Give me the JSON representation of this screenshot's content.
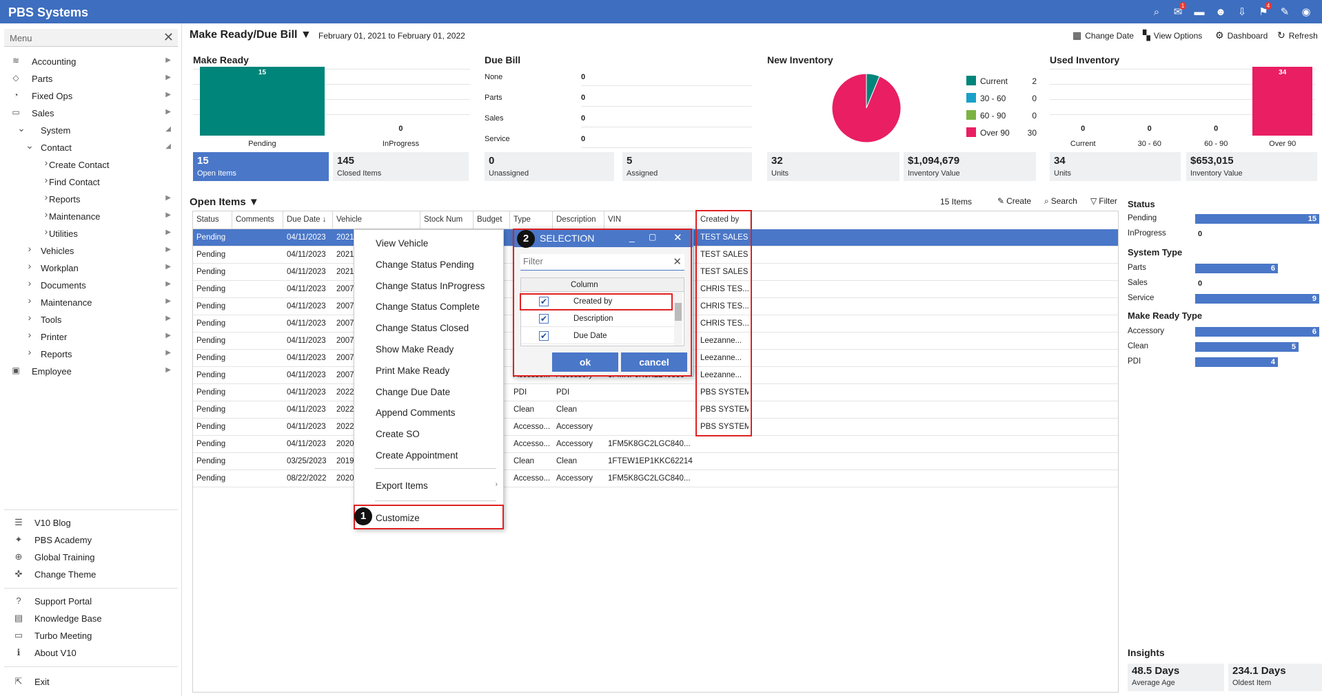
{
  "app_title": "PBS Systems",
  "topbar_icons": [
    {
      "name": "search-icon",
      "glyph": "⌕",
      "badge": ""
    },
    {
      "name": "mail-icon",
      "glyph": "✉",
      "badge": "1"
    },
    {
      "name": "chat-icon",
      "glyph": "▬",
      "badge": ""
    },
    {
      "name": "users-icon",
      "glyph": "☻",
      "badge": ""
    },
    {
      "name": "inbox-icon",
      "glyph": "⇩",
      "badge": ""
    },
    {
      "name": "flag-icon",
      "glyph": "⚑",
      "badge": "4"
    },
    {
      "name": "pin-icon",
      "glyph": "✎",
      "badge": ""
    },
    {
      "name": "eye-icon",
      "glyph": "◉",
      "badge": ""
    }
  ],
  "sidebar": {
    "header": "Menu",
    "items": [
      {
        "label": "Accounting",
        "icon": "database-icon",
        "glyph": "≋",
        "indent": 0,
        "expander": "",
        "arrow": "▶"
      },
      {
        "label": "Parts",
        "icon": "tag-icon",
        "glyph": "◇",
        "indent": 0,
        "expander": "",
        "arrow": "▶"
      },
      {
        "label": "Fixed Ops",
        "icon": "gauge-icon",
        "glyph": "◔",
        "indent": 0,
        "expander": "",
        "arrow": "▶"
      },
      {
        "label": "Sales",
        "icon": "car-icon",
        "glyph": "▭",
        "indent": 0,
        "expander": "",
        "arrow": "▶"
      },
      {
        "label": "System",
        "icon": "expand-icon",
        "glyph": "",
        "indent": 0,
        "expander": "⌄",
        "arrow": "◢"
      },
      {
        "label": "Contact",
        "icon": "expand-icon",
        "glyph": "",
        "indent": 1,
        "expander": "⌄",
        "arrow": "◢"
      },
      {
        "label": "Create Contact",
        "icon": "chevron-right-icon",
        "glyph": "",
        "indent": 2,
        "expander": "›",
        "arrow": ""
      },
      {
        "label": "Find Contact",
        "icon": "chevron-right-icon",
        "glyph": "",
        "indent": 2,
        "expander": "›",
        "arrow": ""
      },
      {
        "label": "Reports",
        "icon": "chevron-right-icon",
        "glyph": "",
        "indent": 2,
        "expander": "›",
        "arrow": "▶"
      },
      {
        "label": "Maintenance",
        "icon": "chevron-right-icon",
        "glyph": "",
        "indent": 2,
        "expander": "›",
        "arrow": "▶"
      },
      {
        "label": "Utilities",
        "icon": "chevron-right-icon",
        "glyph": "",
        "indent": 2,
        "expander": "›",
        "arrow": "▶"
      },
      {
        "label": "Vehicles",
        "icon": "chevron-right-icon",
        "glyph": "",
        "indent": 1,
        "expander": "›",
        "arrow": "▶"
      },
      {
        "label": "Workplan",
        "icon": "chevron-right-icon",
        "glyph": "",
        "indent": 1,
        "expander": "›",
        "arrow": "▶"
      },
      {
        "label": "Documents",
        "icon": "chevron-right-icon",
        "glyph": "",
        "indent": 1,
        "expander": "›",
        "arrow": "▶"
      },
      {
        "label": "Maintenance",
        "icon": "chevron-right-icon",
        "glyph": "",
        "indent": 1,
        "expander": "›",
        "arrow": "▶"
      },
      {
        "label": "Tools",
        "icon": "chevron-right-icon",
        "glyph": "",
        "indent": 1,
        "expander": "›",
        "arrow": "▶"
      },
      {
        "label": "Printer",
        "icon": "chevron-right-icon",
        "glyph": "",
        "indent": 1,
        "expander": "›",
        "arrow": "▶"
      },
      {
        "label": "Reports",
        "icon": "chevron-right-icon",
        "glyph": "",
        "indent": 1,
        "expander": "›",
        "arrow": "▶"
      },
      {
        "label": "Employee",
        "icon": "employee-icon",
        "glyph": "▣",
        "indent": 0,
        "expander": "",
        "arrow": "▶"
      }
    ],
    "links_a": [
      {
        "label": "V10 Blog",
        "icon": "blog-icon",
        "glyph": "☰"
      },
      {
        "label": "PBS Academy",
        "icon": "academy-icon",
        "glyph": "✦"
      },
      {
        "label": "Global Training",
        "icon": "globe-icon",
        "glyph": "⊕"
      },
      {
        "label": "Change Theme",
        "icon": "theme-icon",
        "glyph": "✜"
      }
    ],
    "links_b": [
      {
        "label": "Support Portal",
        "icon": "help-icon",
        "glyph": "?"
      },
      {
        "label": "Knowledge Base",
        "icon": "book-icon",
        "glyph": "▤"
      },
      {
        "label": "Turbo Meeting",
        "icon": "monitor-icon",
        "glyph": "▭"
      },
      {
        "label": "About V10",
        "icon": "info-icon",
        "glyph": "ℹ"
      }
    ],
    "exit": {
      "label": "Exit",
      "icon": "exit-icon",
      "glyph": "⇱"
    }
  },
  "header": {
    "title": "Make Ready/Due Bill",
    "date_range": "February 01, 2021 to February 01, 2022",
    "actions": [
      {
        "label": "Change Date",
        "icon": "calendar-icon",
        "glyph": "▦"
      },
      {
        "label": "View Options",
        "icon": "grid-icon",
        "glyph": "▚"
      },
      {
        "label": "Dashboard",
        "icon": "gear-icon",
        "glyph": "⚙"
      },
      {
        "label": "Refresh",
        "icon": "refresh-icon",
        "glyph": "↻"
      }
    ]
  },
  "panels": {
    "make_ready": {
      "title": "Make Ready",
      "bars": [
        {
          "label": "Pending",
          "value": 15
        },
        {
          "label": "InProgress",
          "value": 0
        }
      ],
      "boxes": [
        {
          "value": "15",
          "label": "Open Items"
        },
        {
          "value": "145",
          "label": "Closed Items"
        }
      ]
    },
    "due_bill": {
      "title": "Due Bill",
      "rows": [
        {
          "label": "None",
          "value": "0"
        },
        {
          "label": "Parts",
          "value": "0"
        },
        {
          "label": "Sales",
          "value": "0"
        },
        {
          "label": "Service",
          "value": "0"
        }
      ],
      "boxes": [
        {
          "value": "0",
          "label": "Unassigned"
        },
        {
          "value": "5",
          "label": "Assigned"
        }
      ]
    },
    "new_inventory": {
      "title": "New Inventory",
      "legend": [
        {
          "label": "Current",
          "value": "2",
          "color": "#00857a"
        },
        {
          "label": "30 - 60",
          "value": "0",
          "color": "#1aa0c8"
        },
        {
          "label": "60 - 90",
          "value": "0",
          "color": "#7cb342"
        },
        {
          "label": "Over 90",
          "value": "30",
          "color": "#e91e63"
        }
      ],
      "boxes": [
        {
          "value": "32",
          "label": "Units"
        },
        {
          "value": "$1,094,679",
          "label": "Inventory Value"
        }
      ]
    },
    "used_inventory": {
      "title": "Used Inventory",
      "bars": [
        {
          "label": "Current",
          "value": 0
        },
        {
          "label": "30 - 60",
          "value": 0
        },
        {
          "label": "60 - 90",
          "value": 0
        },
        {
          "label": "Over 90",
          "value": 34
        }
      ],
      "boxes": [
        {
          "value": "34",
          "label": "Units"
        },
        {
          "value": "$653,015",
          "label": "Inventory Value"
        }
      ]
    }
  },
  "open_items": {
    "title": "Open Items",
    "count": "15 Items",
    "actions": [
      {
        "label": "Create",
        "icon": "pencil-icon",
        "glyph": "✎"
      },
      {
        "label": "Search",
        "icon": "tag-search-icon",
        "glyph": "⌕"
      },
      {
        "label": "Filter",
        "icon": "filter-icon",
        "glyph": "▽"
      }
    ],
    "columns": [
      "Status",
      "Comments",
      "Due Date ↓",
      "Vehicle",
      "Stock Num",
      "Budget",
      "Type",
      "Description",
      "VIN",
      "Created by"
    ],
    "rows": [
      [
        "Pending",
        "",
        "04/11/2023",
        "2021",
        "",
        "",
        "",
        "",
        "",
        "TEST SALES"
      ],
      [
        "Pending",
        "",
        "04/11/2023",
        "2021",
        "",
        "",
        "",
        "",
        "",
        "TEST SALES"
      ],
      [
        "Pending",
        "",
        "04/11/2023",
        "2021",
        "",
        "",
        "",
        "",
        "",
        "TEST SALES"
      ],
      [
        "Pending",
        "",
        "04/11/2023",
        "2007",
        "",
        "",
        "",
        "",
        "",
        "CHRIS TES..."
      ],
      [
        "Pending",
        "",
        "04/11/2023",
        "2007",
        "",
        "",
        "",
        "",
        "",
        "CHRIS TES..."
      ],
      [
        "Pending",
        "",
        "04/11/2023",
        "2007",
        "",
        "",
        "",
        "",
        "",
        "CHRIS TES..."
      ],
      [
        "Pending",
        "",
        "04/11/2023",
        "2007",
        "",
        "",
        "",
        "",
        "",
        "Leezanne..."
      ],
      [
        "Pending",
        "",
        "04/11/2023",
        "2007",
        "",
        "",
        "",
        "",
        "",
        "Leezanne..."
      ],
      [
        "Pending",
        "",
        "04/11/2023",
        "2007",
        "",
        "",
        "Accesso...",
        "Accessory",
        "3FMNF6K6KLL40859",
        "Leezanne..."
      ],
      [
        "Pending",
        "",
        "04/11/2023",
        "2022",
        "",
        "",
        "PDI",
        "PDI",
        "",
        "PBS SYSTEM"
      ],
      [
        "Pending",
        "",
        "04/11/2023",
        "2022",
        "",
        "",
        "Clean",
        "Clean",
        "",
        "PBS SYSTEM"
      ],
      [
        "Pending",
        "",
        "04/11/2023",
        "2022",
        "",
        "",
        "Accesso...",
        "Accessory",
        "",
        "PBS SYSTEM"
      ],
      [
        "Pending",
        "",
        "04/11/2023",
        "2020",
        "",
        "",
        "Accesso...",
        "Accessory",
        "1FM5K8GC2LGC840...",
        ""
      ],
      [
        "Pending",
        "",
        "03/25/2023",
        "2019",
        "",
        "",
        "Clean",
        "Clean",
        "1FTEW1EP1KKC62214",
        ""
      ],
      [
        "Pending",
        "",
        "08/22/2022",
        "2020",
        "",
        "",
        "Accesso...",
        "Accessory",
        "1FM5K8GC2LGC840...",
        ""
      ]
    ]
  },
  "context_menu": {
    "items": [
      "View Vehicle",
      "Change Status Pending",
      "Change Status InProgress",
      "Change Status Complete",
      "Change Status Closed",
      "Show Make Ready",
      "Print Make Ready",
      "Change Due Date",
      "Append Comments",
      "Create SO",
      "Create Appointment"
    ],
    "export": "Export Items",
    "customize": "Customize"
  },
  "selection_dialog": {
    "title": "SELECTION",
    "filter_placeholder": "Filter",
    "column_header": "Column",
    "columns": [
      {
        "label": "Created by",
        "checked": true
      },
      {
        "label": "Description",
        "checked": true
      },
      {
        "label": "Due Date",
        "checked": true
      }
    ],
    "ok": "ok",
    "cancel": "cancel"
  },
  "steps": [
    "1",
    "2"
  ],
  "right_panel": {
    "status_title": "Status",
    "status": [
      {
        "label": "Pending",
        "value": 15
      },
      {
        "label": "InProgress",
        "value": 0
      }
    ],
    "system_type_title": "System Type",
    "system_type": [
      {
        "label": "Parts",
        "value": 6
      },
      {
        "label": "Sales",
        "value": 0
      },
      {
        "label": "Service",
        "value": 9
      }
    ],
    "make_ready_type_title": "Make Ready Type",
    "make_ready_type": [
      {
        "label": "Accessory",
        "value": 6
      },
      {
        "label": "Clean",
        "value": 5
      },
      {
        "label": "PDI",
        "value": 4
      }
    ],
    "insights_title": "Insights",
    "insights": [
      {
        "value": "48.5 Days",
        "label": "Average Age"
      },
      {
        "value": "234.1 Days",
        "label": "Oldest Item"
      }
    ]
  },
  "colors": {
    "accent": "#3e6ebf",
    "teal": "#00857a",
    "pink": "#e91e63",
    "highlight": "#e02020"
  }
}
